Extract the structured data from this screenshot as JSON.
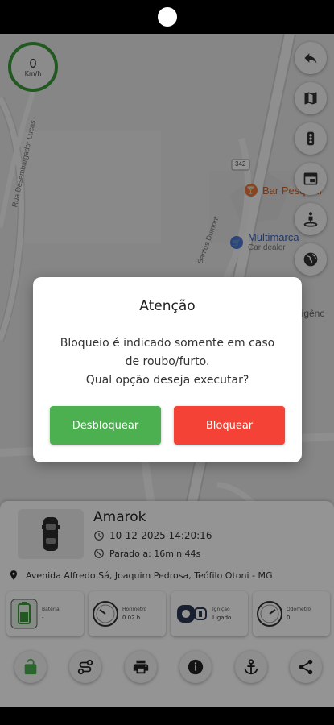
{
  "speedometer": {
    "value": "0",
    "unit": "Km/h"
  },
  "map": {
    "pois": [
      {
        "name": "Bar Pesqueir",
        "color": "#e8793a",
        "icon": "bar-icon"
      },
      {
        "name": "Multimarca",
        "sub": "Car dealer",
        "color": "#4a78d6",
        "icon": "car-dealer-icon"
      }
    ],
    "labels": {
      "road_number": "342",
      "street_1": "Rua Desembargador Lucas",
      "street_2": "Santos Dumont",
      "right_edge": "ligênc"
    }
  },
  "map_controls": [
    "back-arrow-icon",
    "map-icon",
    "traffic-light-icon",
    "layers-icon",
    "street-view-icon",
    "globe-icon"
  ],
  "dialog": {
    "title": "Atenção",
    "line1": "Bloqueio é indicado somente em caso",
    "line2": "de roubo/furto.",
    "line3": "Qual opção deseja executar?",
    "unlock_label": "Desbloquear",
    "lock_label": "Bloquear"
  },
  "vehicle": {
    "name": "Amarok",
    "datetime": "10-12-2025 14:20:16",
    "stopped": "Parado a: 16min 44s",
    "address": "Avenida Alfredo Sá, Joaquim Pedrosa, Teófilo Otoni - MG"
  },
  "stats": [
    {
      "label": "Bateria",
      "value": "-"
    },
    {
      "label": "Horímetro",
      "value": "0.02 h"
    },
    {
      "label": "Ignição",
      "value": "Ligado"
    },
    {
      "label": "Odômetro",
      "value": "0"
    }
  ],
  "actions": [
    "lock-open-icon",
    "route-icon",
    "printer-icon",
    "info-icon",
    "anchor-icon",
    "share-icon"
  ],
  "colors": {
    "green": "#4caf50",
    "red": "#f44336",
    "speed_ring": "#3a9a3a"
  }
}
